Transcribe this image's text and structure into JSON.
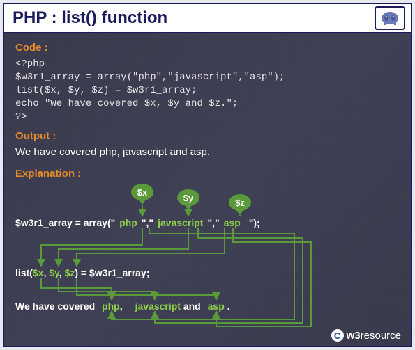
{
  "title": "PHP : list() function",
  "logo_icon": "php-elephant-icon",
  "sections": {
    "code_label": "Code :",
    "code_text": "<?php\n$w3r1_array = array(\"php\",\"javascript\",\"asp\");\nlist($x, $y, $z) = $w3r1_array;\necho \"We have covered $x, $y and $z.\";\n?>",
    "output_label": "Output :",
    "output_text": "We have covered php, javascript and asp.",
    "explanation_label": "Explanation :"
  },
  "bubbles": {
    "x": "$x",
    "y": "$y",
    "z": "$z"
  },
  "diagram": {
    "array_prefix": "$w3r1_array = array(\"",
    "array_sep": "\",\"",
    "array_item1": "php",
    "array_item2": "javascript",
    "array_item3": "asp",
    "array_suffix": "\");",
    "list_prefix": "list(",
    "list_var1": "$x",
    "list_comma": ", ",
    "list_var2": "$y",
    "list_var3": "$z",
    "list_suffix": ") = $w3r1_array;",
    "echo_prefix": "We have covered ",
    "echo_v1": "php",
    "echo_c1": ",",
    "echo_v2": "javascript",
    "echo_and": " and ",
    "echo_v3": "asp",
    "echo_dot": " ."
  },
  "footer": {
    "c": "C",
    "brand1": "w3",
    "brand2": "resource"
  },
  "colors": {
    "accent": "#e88a2a",
    "green": "#5a9a3a",
    "dark": "#1a1a5c"
  }
}
